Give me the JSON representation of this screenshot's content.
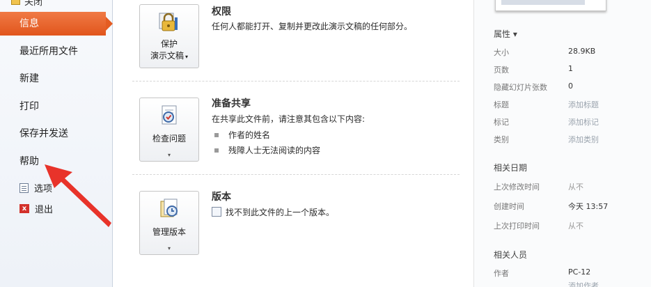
{
  "nav": {
    "top_partial": "关闭",
    "items": [
      {
        "label": "信息"
      },
      {
        "label": "最近所用文件"
      },
      {
        "label": "新建"
      },
      {
        "label": "打印"
      },
      {
        "label": "保存并发送"
      },
      {
        "label": "帮助"
      }
    ],
    "options_label": "选项",
    "exit_label": "退出",
    "exit_icon_glyph": "x"
  },
  "permissions": {
    "button_line1": "保护",
    "button_line2": "演示文稿",
    "button_caret": "▾",
    "title": "权限",
    "desc": "任何人都能打开、复制并更改此演示文稿的任何部分。"
  },
  "share": {
    "button_label": "检查问题",
    "button_caret": "▾",
    "title": "准备共享",
    "desc": "在共享此文件前，请注意其包含以下内容:",
    "bullets": [
      "作者的姓名",
      "残障人士无法阅读的内容"
    ]
  },
  "versions": {
    "button_label": "管理版本",
    "button_caret": "▾",
    "title": "版本",
    "desc": "找不到此文件的上一个版本。"
  },
  "properties": {
    "header": "属性 ▾",
    "rows": [
      {
        "label": "大小",
        "value": "28.9KB"
      },
      {
        "label": "页数",
        "value": "1"
      },
      {
        "label": "隐藏幻灯片张数",
        "value": "0"
      },
      {
        "label": "标题",
        "value": "添加标题"
      },
      {
        "label": "标记",
        "value": "添加标记"
      },
      {
        "label": "类别",
        "value": "添加类别"
      }
    ]
  },
  "dates": {
    "header": "相关日期",
    "rows": [
      {
        "label": "上次修改时间",
        "value": "从不"
      },
      {
        "label": "创建时间",
        "value": "今天 13:57"
      },
      {
        "label": "上次打印时间",
        "value": "从不"
      }
    ]
  },
  "people": {
    "header": "相关人员",
    "rows": [
      {
        "label": "作者",
        "value": "PC-12"
      }
    ],
    "partial": "添加作者"
  },
  "colors": {
    "active_nav": "#e45c22",
    "arrow": "#e8332a"
  }
}
